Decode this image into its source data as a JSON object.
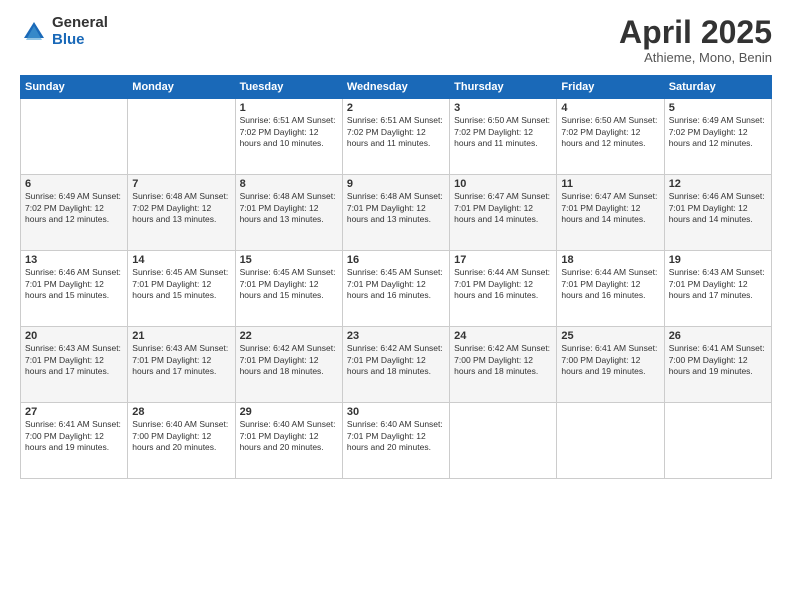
{
  "logo": {
    "general": "General",
    "blue": "Blue"
  },
  "title": "April 2025",
  "subtitle": "Athieme, Mono, Benin",
  "days_of_week": [
    "Sunday",
    "Monday",
    "Tuesday",
    "Wednesday",
    "Thursday",
    "Friday",
    "Saturday"
  ],
  "weeks": [
    [
      {
        "day": "",
        "content": ""
      },
      {
        "day": "",
        "content": ""
      },
      {
        "day": "1",
        "content": "Sunrise: 6:51 AM\nSunset: 7:02 PM\nDaylight: 12 hours and 10 minutes."
      },
      {
        "day": "2",
        "content": "Sunrise: 6:51 AM\nSunset: 7:02 PM\nDaylight: 12 hours and 11 minutes."
      },
      {
        "day": "3",
        "content": "Sunrise: 6:50 AM\nSunset: 7:02 PM\nDaylight: 12 hours and 11 minutes."
      },
      {
        "day": "4",
        "content": "Sunrise: 6:50 AM\nSunset: 7:02 PM\nDaylight: 12 hours and 12 minutes."
      },
      {
        "day": "5",
        "content": "Sunrise: 6:49 AM\nSunset: 7:02 PM\nDaylight: 12 hours and 12 minutes."
      }
    ],
    [
      {
        "day": "6",
        "content": "Sunrise: 6:49 AM\nSunset: 7:02 PM\nDaylight: 12 hours and 12 minutes."
      },
      {
        "day": "7",
        "content": "Sunrise: 6:48 AM\nSunset: 7:02 PM\nDaylight: 12 hours and 13 minutes."
      },
      {
        "day": "8",
        "content": "Sunrise: 6:48 AM\nSunset: 7:01 PM\nDaylight: 12 hours and 13 minutes."
      },
      {
        "day": "9",
        "content": "Sunrise: 6:48 AM\nSunset: 7:01 PM\nDaylight: 12 hours and 13 minutes."
      },
      {
        "day": "10",
        "content": "Sunrise: 6:47 AM\nSunset: 7:01 PM\nDaylight: 12 hours and 14 minutes."
      },
      {
        "day": "11",
        "content": "Sunrise: 6:47 AM\nSunset: 7:01 PM\nDaylight: 12 hours and 14 minutes."
      },
      {
        "day": "12",
        "content": "Sunrise: 6:46 AM\nSunset: 7:01 PM\nDaylight: 12 hours and 14 minutes."
      }
    ],
    [
      {
        "day": "13",
        "content": "Sunrise: 6:46 AM\nSunset: 7:01 PM\nDaylight: 12 hours and 15 minutes."
      },
      {
        "day": "14",
        "content": "Sunrise: 6:45 AM\nSunset: 7:01 PM\nDaylight: 12 hours and 15 minutes."
      },
      {
        "day": "15",
        "content": "Sunrise: 6:45 AM\nSunset: 7:01 PM\nDaylight: 12 hours and 15 minutes."
      },
      {
        "day": "16",
        "content": "Sunrise: 6:45 AM\nSunset: 7:01 PM\nDaylight: 12 hours and 16 minutes."
      },
      {
        "day": "17",
        "content": "Sunrise: 6:44 AM\nSunset: 7:01 PM\nDaylight: 12 hours and 16 minutes."
      },
      {
        "day": "18",
        "content": "Sunrise: 6:44 AM\nSunset: 7:01 PM\nDaylight: 12 hours and 16 minutes."
      },
      {
        "day": "19",
        "content": "Sunrise: 6:43 AM\nSunset: 7:01 PM\nDaylight: 12 hours and 17 minutes."
      }
    ],
    [
      {
        "day": "20",
        "content": "Sunrise: 6:43 AM\nSunset: 7:01 PM\nDaylight: 12 hours and 17 minutes."
      },
      {
        "day": "21",
        "content": "Sunrise: 6:43 AM\nSunset: 7:01 PM\nDaylight: 12 hours and 17 minutes."
      },
      {
        "day": "22",
        "content": "Sunrise: 6:42 AM\nSunset: 7:01 PM\nDaylight: 12 hours and 18 minutes."
      },
      {
        "day": "23",
        "content": "Sunrise: 6:42 AM\nSunset: 7:01 PM\nDaylight: 12 hours and 18 minutes."
      },
      {
        "day": "24",
        "content": "Sunrise: 6:42 AM\nSunset: 7:00 PM\nDaylight: 12 hours and 18 minutes."
      },
      {
        "day": "25",
        "content": "Sunrise: 6:41 AM\nSunset: 7:00 PM\nDaylight: 12 hours and 19 minutes."
      },
      {
        "day": "26",
        "content": "Sunrise: 6:41 AM\nSunset: 7:00 PM\nDaylight: 12 hours and 19 minutes."
      }
    ],
    [
      {
        "day": "27",
        "content": "Sunrise: 6:41 AM\nSunset: 7:00 PM\nDaylight: 12 hours and 19 minutes."
      },
      {
        "day": "28",
        "content": "Sunrise: 6:40 AM\nSunset: 7:00 PM\nDaylight: 12 hours and 20 minutes."
      },
      {
        "day": "29",
        "content": "Sunrise: 6:40 AM\nSunset: 7:01 PM\nDaylight: 12 hours and 20 minutes."
      },
      {
        "day": "30",
        "content": "Sunrise: 6:40 AM\nSunset: 7:01 PM\nDaylight: 12 hours and 20 minutes."
      },
      {
        "day": "",
        "content": ""
      },
      {
        "day": "",
        "content": ""
      },
      {
        "day": "",
        "content": ""
      }
    ]
  ]
}
